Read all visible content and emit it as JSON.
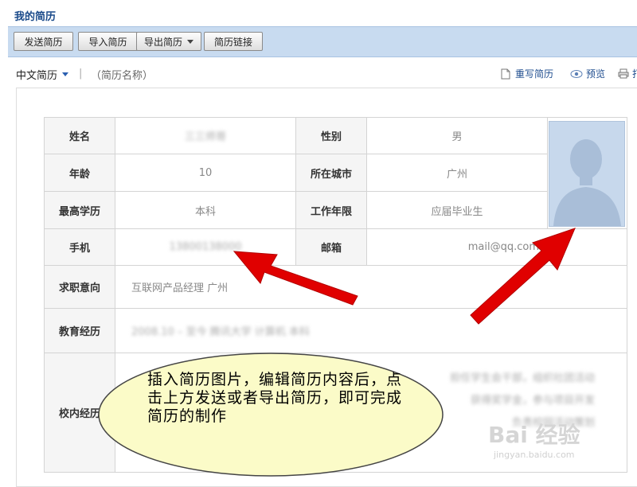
{
  "header": {
    "title": "我的简历"
  },
  "toolbar": {
    "send": "发送简历",
    "import": "导入简历",
    "export": "导出简历",
    "link": "简历链接"
  },
  "subbar": {
    "language": "中文简历",
    "separator": "|",
    "resume_name": "（简历名称）",
    "rewrite": "重写简历",
    "preview": "预览",
    "print": "打"
  },
  "resume": {
    "labels": {
      "name": "姓名",
      "gender": "性别",
      "age": "年龄",
      "city": "所在城市",
      "education": "最高学历",
      "work_years": "工作年限",
      "phone": "手机",
      "email": "邮箱",
      "intention": "求职意向",
      "edu_history": "教育经历",
      "campus": "校内经历"
    },
    "values": {
      "name": "三三师哥",
      "gender": "男",
      "age": "10",
      "city": "广州",
      "education": "本科",
      "work_years": "应届毕业生",
      "phone": "13800138000",
      "email": "mail@qq.com",
      "intention": "互联网产品经理   广州",
      "edu_history": "2008.10 – 至今  腾讯大学  计算机  本科",
      "campus_line1": "担任学生会干部，组织社团活动",
      "campus_line2": "获得奖学金，参与项目开发",
      "campus_line3": "负责校园活动策划"
    }
  },
  "callout": {
    "text": "插入简历图片，编辑简历内容后，点击上方发送或者导出简历，即可完成简历的制作"
  },
  "watermark": {
    "brand": "Bai 经验",
    "url": "jingyan.baidu.com"
  },
  "colors": {
    "toolbar_bg": "#c8dbf0",
    "title": "#1a4a8a",
    "arrow": "#e00000",
    "bubble_fill": "#fbfbc8"
  }
}
